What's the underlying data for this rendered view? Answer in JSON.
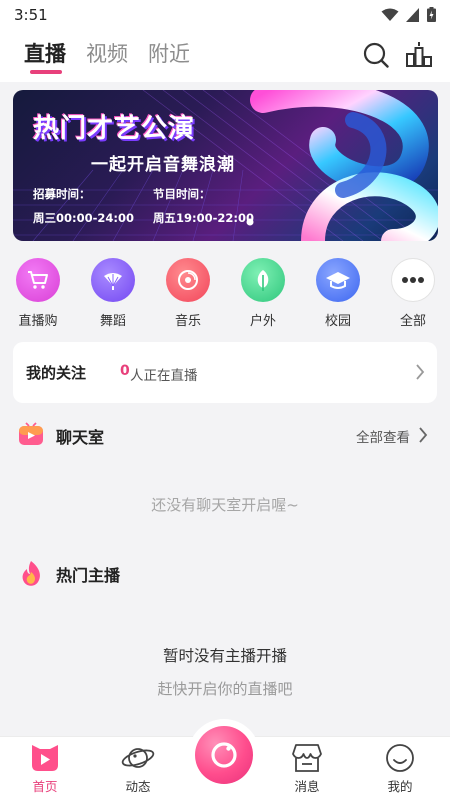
{
  "status_bar": {
    "time": "3:51"
  },
  "top_nav": {
    "tabs": [
      {
        "label": "直播",
        "active": true
      },
      {
        "label": "视频",
        "active": false
      },
      {
        "label": "附近",
        "active": false
      }
    ],
    "icons": [
      "search-icon",
      "ranking-icon"
    ]
  },
  "banner": {
    "title": "热门才艺公演",
    "subtitle": "一起开启音舞浪潮",
    "recruit_label": "招募时间：",
    "recruit_time": "周三00:00-24:00",
    "show_label": "节目时间：",
    "show_time": "周五19:00-22:00"
  },
  "categories": [
    {
      "label": "直播购",
      "icon": "shopping-cart-icon",
      "color": "#e14de0"
    },
    {
      "label": "舞蹈",
      "icon": "fan-icon",
      "color": "#8a63ff"
    },
    {
      "label": "音乐",
      "icon": "record-icon",
      "color": "#ff5a6e"
    },
    {
      "label": "户外",
      "icon": "leaf-icon",
      "color": "#3ed58a"
    },
    {
      "label": "校园",
      "icon": "graduation-cap-icon",
      "color": "#4f7dff"
    },
    {
      "label": "全部",
      "icon": "more-icon",
      "color": "#ffffff"
    }
  ],
  "follow": {
    "title": "我的关注",
    "count": "0",
    "live_text": "人正在直播"
  },
  "chatroom": {
    "title": "聊天室",
    "more": "全部查看",
    "empty": "还没有聊天室开启喔~"
  },
  "hot_anchor": {
    "title": "热门主播",
    "empty_title": "暂时没有主播开播",
    "empty_subtitle": "赶快开启你的直播吧"
  },
  "bottom_nav": [
    {
      "label": "首页",
      "active": true
    },
    {
      "label": "动态",
      "active": false
    },
    {
      "label": "消息",
      "active": false
    },
    {
      "label": "我的",
      "active": false
    }
  ],
  "colors": {
    "accent": "#e8407b"
  }
}
